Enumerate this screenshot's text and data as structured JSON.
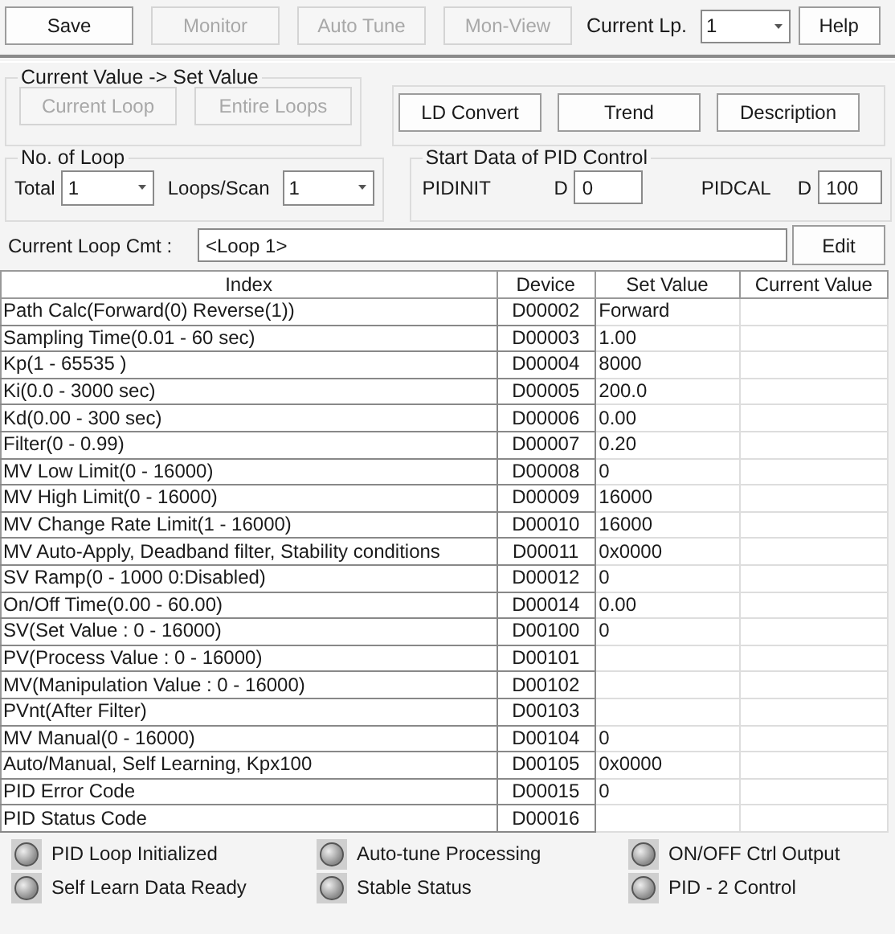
{
  "toolbar": {
    "buttons": [
      {
        "label": "Save",
        "disabled": false
      },
      {
        "label": "Monitor",
        "disabled": true
      },
      {
        "label": "Auto Tune",
        "disabled": true
      },
      {
        "label": "Mon-View",
        "disabled": true
      }
    ],
    "current_lp": {
      "label": "Current Lp.",
      "value": "1"
    },
    "help": {
      "label": "Help",
      "disabled": false
    }
  },
  "copy_group": {
    "title": "Current Value -> Set Value",
    "buttons": [
      {
        "label": "Current Loop",
        "disabled": true
      },
      {
        "label": "Entire Loops",
        "disabled": true
      }
    ]
  },
  "action_buttons": [
    {
      "label": "LD Convert",
      "disabled": false
    },
    {
      "label": "Trend",
      "disabled": false
    },
    {
      "label": "Description",
      "disabled": false
    }
  ],
  "loop_group": {
    "title": "No. of Loop",
    "total": {
      "label": "Total",
      "value": "1"
    },
    "loops_per_scan": {
      "label": "Loops/Scan",
      "value": "1"
    }
  },
  "start_group": {
    "title": "Start Data of PID Control",
    "fields": [
      {
        "label": "PIDINIT",
        "prefix": "D",
        "value": "0"
      },
      {
        "label": "PIDCAL",
        "prefix": "D",
        "value": "100"
      }
    ]
  },
  "comment": {
    "label": "Current Loop Cmt :",
    "value": "<Loop 1>",
    "button": "Edit"
  },
  "table": {
    "columns": [
      "Index",
      "Device",
      "Set Value",
      "Current Value"
    ],
    "rows": [
      [
        "Path Calc(Forward(0) Reverse(1))",
        "D00002",
        "Forward",
        ""
      ],
      [
        "Sampling Time(0.01 - 60 sec)",
        "D00003",
        "1.00",
        ""
      ],
      [
        "Kp(1 - 65535 )",
        "D00004",
        "8000",
        ""
      ],
      [
        "Ki(0.0 - 3000 sec)",
        "D00005",
        "200.0",
        ""
      ],
      [
        "Kd(0.00 - 300 sec)",
        "D00006",
        "0.00",
        ""
      ],
      [
        "Filter(0 - 0.99)",
        "D00007",
        "0.20",
        ""
      ],
      [
        "MV Low Limit(0 - 16000)",
        "D00008",
        "0",
        ""
      ],
      [
        "MV High Limit(0 - 16000)",
        "D00009",
        "16000",
        ""
      ],
      [
        "MV Change Rate Limit(1 - 16000)",
        "D00010",
        "16000",
        ""
      ],
      [
        "MV Auto-Apply, Deadband filter, Stability conditions",
        "D00011",
        "0x0000",
        ""
      ],
      [
        "SV Ramp(0 - 1000    0:Disabled)",
        "D00012",
        "0",
        ""
      ],
      [
        "On/Off Time(0.00 - 60.00)",
        "D00014",
        "0.00",
        ""
      ],
      [
        "SV(Set Value : 0 - 16000)",
        "D00100",
        "0",
        ""
      ],
      [
        "PV(Process Value : 0 - 16000)",
        "D00101",
        "",
        ""
      ],
      [
        "MV(Manipulation Value : 0 - 16000)",
        "D00102",
        "",
        ""
      ],
      [
        "PVnt(After Filter)",
        "D00103",
        "",
        ""
      ],
      [
        "MV Manual(0 - 16000)",
        "D00104",
        "0",
        ""
      ],
      [
        "Auto/Manual, Self Learning, Kpx100",
        "D00105",
        "0x0000",
        ""
      ],
      [
        "PID Error Code",
        "D00015",
        "0",
        ""
      ],
      [
        "PID Status Code",
        "D00016",
        "",
        ""
      ]
    ]
  },
  "indicators": [
    {
      "label": "PID Loop Initialized",
      "on": false
    },
    {
      "label": "Auto-tune Processing",
      "on": false
    },
    {
      "label": "ON/OFF Ctrl Output",
      "on": false
    },
    {
      "label": "Self Learn Data Ready",
      "on": false
    },
    {
      "label": "Stable Status",
      "on": false
    },
    {
      "label": "PID - 2 Control",
      "on": false
    }
  ]
}
